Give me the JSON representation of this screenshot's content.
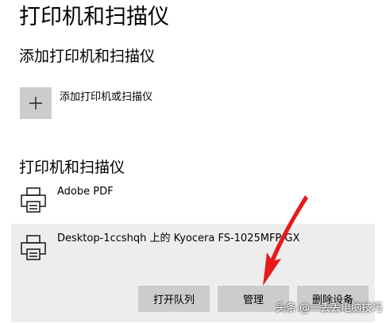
{
  "page": {
    "title": "打印机和扫描仪"
  },
  "add_section": {
    "title": "添加打印机和扫描仪",
    "add_button_label": "添加打印机或扫描仪",
    "add_icon": "plus-icon"
  },
  "printers_section": {
    "title": "打印机和扫描仪",
    "printer_icon": "printer-icon",
    "printers": [
      {
        "name": "Adobe PDF"
      },
      {
        "name": "Desktop-1ccshqh 上的 Kyocera FS-1025MFP GX"
      }
    ],
    "actions": {
      "open_queue": "打开队列",
      "manage": "管理",
      "remove_device": "删除设备"
    }
  },
  "annotation": {
    "arrow_color": "#e8191a"
  },
  "watermark": {
    "text": "头条 @一丢丢电脑技巧"
  },
  "colors": {
    "button_bg": "#cccccc",
    "selected_row_bg": "#ededed",
    "plus_box_bg": "#cccccc"
  }
}
